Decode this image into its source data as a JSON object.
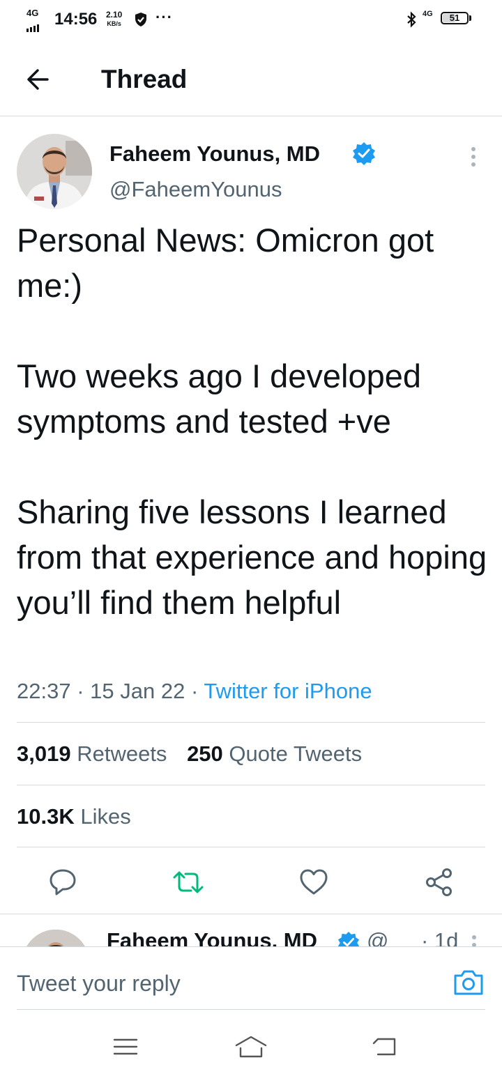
{
  "status_bar": {
    "network_left": "4G",
    "time": "14:56",
    "speed_value": "2.10",
    "speed_unit": "KB/s",
    "overflow": "···",
    "network_right": "4G",
    "battery": "51",
    "battery_level": 0.51
  },
  "header": {
    "title": "Thread"
  },
  "tweet": {
    "author_name": "Faheem Younus, MD",
    "handle": "@FaheemYounus",
    "paragraphs": [
      "Personal News: Omicron got me:)",
      "Two weeks ago I developed symptoms and tested +ve",
      "Sharing five lessons I learned from that experience and hoping you’ll find them helpful"
    ],
    "time": "22:37",
    "date": "15 Jan 22",
    "source": "Twitter for iPhone",
    "separator": "·",
    "retweets_count": "3,019",
    "retweets_label": "Retweets",
    "quotes_count": "250",
    "quotes_label": "Quote Tweets",
    "likes_count": "10.3K",
    "likes_label": "Likes"
  },
  "reply_preview": {
    "author_name": "Faheem Younus, MD",
    "handle": "@",
    "time": "· 1d"
  },
  "compose": {
    "placeholder": "Tweet your reply"
  },
  "colors": {
    "accent": "#1d9bf0",
    "retweet_green": "#00ba7c",
    "text": "#0f1419",
    "muted": "#536471"
  }
}
